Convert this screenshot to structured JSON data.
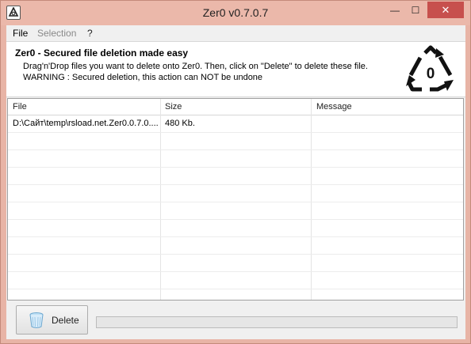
{
  "window": {
    "title": "Zer0 v0.7.0.7",
    "minimize_label": "—",
    "maximize_label": "☐",
    "close_label": "✕"
  },
  "menu": {
    "file": "File",
    "selection": "Selection",
    "help": "?"
  },
  "header": {
    "title": "Zer0 - Secured file deletion made easy",
    "description": "Drag'n'Drop files you want to delete onto Zer0. Then, click on \"Delete\" to delete these file.",
    "warning": "WARNING : Secured deletion, this action can NOT be undone",
    "logo_text": "0",
    "logo_icon": "recycle-zero-icon"
  },
  "list": {
    "columns": [
      "File",
      "Size",
      "Message"
    ],
    "rows": [
      {
        "file": "D:\\Сайт\\temp\\rsload.net.Zer0.0.7.0....",
        "size": "480 Kb.",
        "message": ""
      }
    ]
  },
  "footer": {
    "delete_label": "Delete",
    "progress_percent": 0
  }
}
